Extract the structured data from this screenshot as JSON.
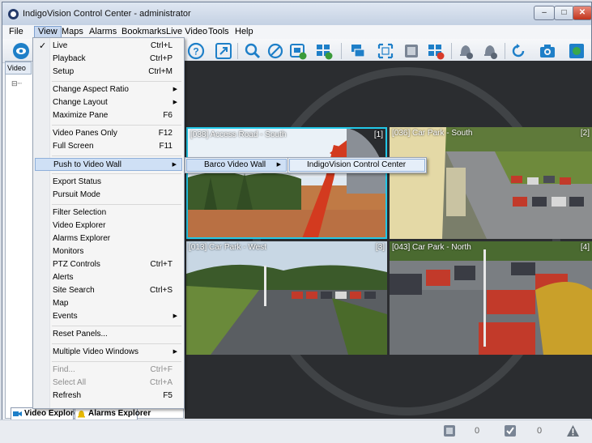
{
  "window": {
    "title": "IndigoVision Control Center - administrator"
  },
  "menubar": [
    "File",
    "View",
    "Maps",
    "Alarms",
    "Bookmarks",
    "Live Video",
    "Tools",
    "Help"
  ],
  "view_menu": [
    {
      "label": "Live",
      "shortcut": "Ctrl+L",
      "checked": true
    },
    {
      "label": "Playback",
      "shortcut": "Ctrl+P"
    },
    {
      "label": "Setup",
      "shortcut": "Ctrl+M"
    },
    {
      "label": "Change Aspect Ratio",
      "submenu": true
    },
    {
      "label": "Change Layout",
      "submenu": true
    },
    {
      "label": "Maximize Pane",
      "shortcut": "F6"
    },
    {
      "label": "Video Panes Only",
      "shortcut": "F12"
    },
    {
      "label": "Full Screen",
      "shortcut": "F11"
    },
    {
      "label": "Push to Video Wall",
      "submenu": true,
      "highlighted": true
    },
    {
      "label": "Export Status"
    },
    {
      "label": "Pursuit Mode"
    },
    {
      "label": "Filter Selection"
    },
    {
      "label": "Video Explorer"
    },
    {
      "label": "Alarms Explorer"
    },
    {
      "label": "Monitors"
    },
    {
      "label": "PTZ Controls",
      "shortcut": "Ctrl+T"
    },
    {
      "label": "Alerts"
    },
    {
      "label": "Site Search",
      "shortcut": "Ctrl+S"
    },
    {
      "label": "Map"
    },
    {
      "label": "Events",
      "submenu": true
    },
    {
      "label": "Reset Panels..."
    },
    {
      "label": "Multiple Video Windows",
      "submenu": true
    },
    {
      "label": "Find...",
      "shortcut": "Ctrl+F",
      "disabled": true
    },
    {
      "label": "Select All",
      "shortcut": "Ctrl+A",
      "disabled": true
    },
    {
      "label": "Refresh",
      "shortcut": "F5"
    }
  ],
  "submenu_video_wall": {
    "label": "Barco Video Wall"
  },
  "submenu_barco": {
    "label": "IndigoVision Control Center"
  },
  "left_panel": {
    "tab": "Video",
    "bottom_tabs": [
      "Video Explorer",
      "Alarms Explorer"
    ]
  },
  "panes": [
    {
      "label": "[038] Access Road - South",
      "index": "[1]"
    },
    {
      "label": "[036] Car Park - South",
      "index": "[2]"
    },
    {
      "label": "[013] Car Park - West",
      "index": "[3]"
    },
    {
      "label": "[043] Car Park - North",
      "index": "[4]"
    }
  ],
  "statusbar": {
    "count1": "0",
    "count2": "0"
  },
  "colors": {
    "accent": "#1e7fc8",
    "pane_selected": "#22c8e8",
    "menu_highlight": "#cfe0f5"
  }
}
